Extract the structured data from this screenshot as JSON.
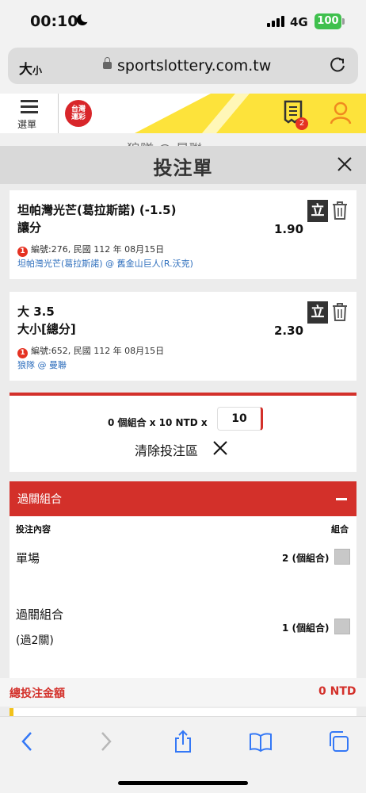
{
  "status": {
    "time": "00:10",
    "network": "4G",
    "battery": "100"
  },
  "browser": {
    "text_size": "大",
    "text_size_small": "小",
    "url": "sportslottery.com.tw"
  },
  "site": {
    "menu_label": "選單",
    "logo_line1": "台灣",
    "logo_line2": "運彩",
    "slip_count": "2",
    "behind_text": "狼隊 @ 曼聯"
  },
  "slip": {
    "title": "投注單",
    "bets": [
      {
        "team": "坦帕灣光芒(葛拉斯諾) (-1.5)",
        "market": "讓分",
        "odds": "1.90",
        "li": "立",
        "warn": "1",
        "info": "編號:276, 民國 112 年 08月15日",
        "match": "坦帕灣光芒(葛拉斯諾) @ 舊金山巨人(R.沃克)"
      },
      {
        "team": "大 3.5",
        "market": "大小[總分]",
        "odds": "2.30",
        "li": "立",
        "warn": "1",
        "info": "編號:652, 民國 112 年 08月15日",
        "match": "狼隊 @ 曼聯"
      }
    ],
    "combo_text": "0 個組合 x 10 NTD x",
    "stake": "10",
    "clear_label": "清除投注區"
  },
  "parlay": {
    "title": "過關組合",
    "col_content": "投注內容",
    "col_combo": "組合",
    "rows": [
      {
        "label": "單場",
        "sub": "",
        "value": "2 (個組合)",
        "checked": false
      },
      {
        "label": "過關組合",
        "sub": "(過2關)",
        "value": "1 (個組合)",
        "checked": false
      }
    ]
  },
  "total": {
    "label": "總投注金額",
    "value": "0 NTD"
  },
  "colors": {
    "accent_red": "#d3302a",
    "link_blue": "#2f6fbd",
    "brand_yellow": "#fde33b",
    "ios_blue": "#3478f6"
  }
}
